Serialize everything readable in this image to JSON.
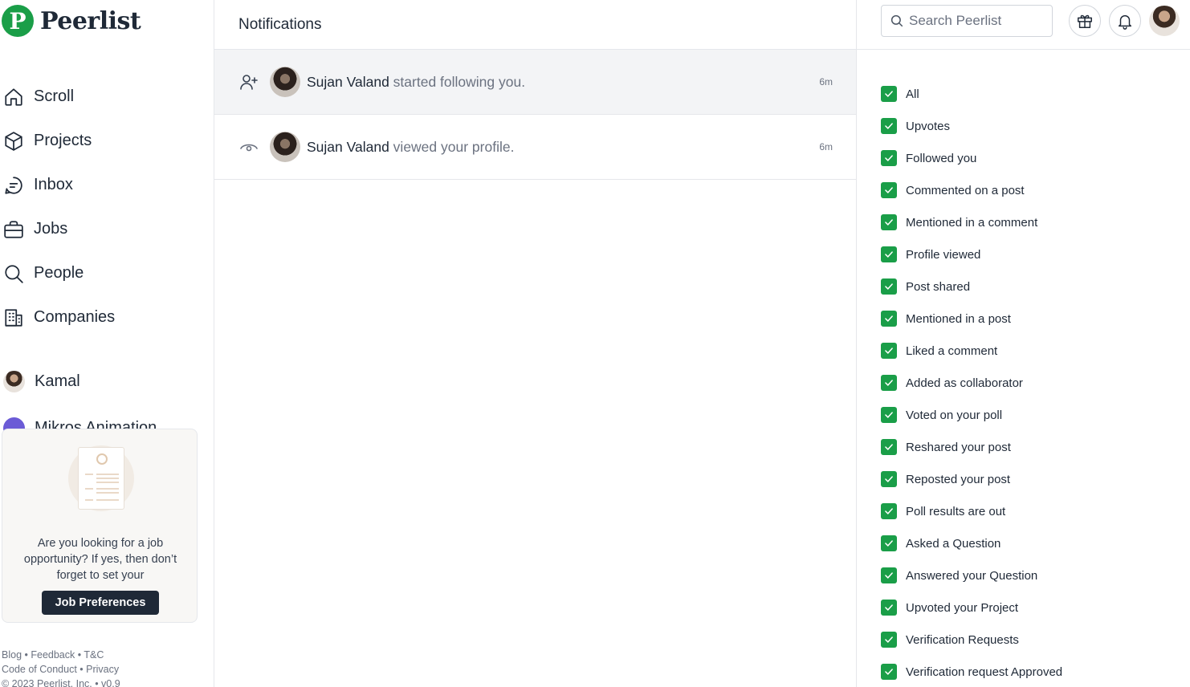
{
  "brand": {
    "name": "Peerlist",
    "badge_letter": "P",
    "color": "#1a9e48"
  },
  "nav": [
    {
      "label": "Scroll",
      "icon": "home-icon"
    },
    {
      "label": "Projects",
      "icon": "cube-icon"
    },
    {
      "label": "Inbox",
      "icon": "chat-icon"
    },
    {
      "label": "Jobs",
      "icon": "briefcase-icon"
    },
    {
      "label": "People",
      "icon": "search-icon"
    },
    {
      "label": "Companies",
      "icon": "building-icon"
    }
  ],
  "profile": {
    "name": "Kamal"
  },
  "secondary_profile": {
    "name": "Mikros Animation"
  },
  "job_card": {
    "text": "Are you looking for a job opportunity? If yes, then don’t forget to set your",
    "button": "Job Preferences"
  },
  "footer": {
    "blog": "Blog",
    "feedback": "Feedback",
    "tc": "T&C",
    "conduct": "Code of Conduct",
    "privacy": "Privacy",
    "copyright": "© 2023 Peerlist, Inc. • v0.9"
  },
  "main": {
    "title": "Notifications",
    "notifications": [
      {
        "icon": "user-plus-icon",
        "user": "Sujan Valand",
        "action": " started following you.",
        "time": "6m",
        "unread": true
      },
      {
        "icon": "eye-icon",
        "user": "Sujan Valand",
        "action": " viewed your profile.",
        "time": "6m",
        "unread": false
      }
    ]
  },
  "search": {
    "placeholder": "Search Peerlist"
  },
  "filters": [
    "All",
    "Upvotes",
    "Followed you",
    "Commented on a post",
    "Mentioned in a comment",
    "Profile viewed",
    "Post shared",
    "Mentioned in a post",
    "Liked a comment",
    "Added as collaborator",
    "Voted on your poll",
    "Reshared your post",
    "Reposted your post",
    "Poll results are out",
    "Asked a Question",
    "Answered your Question",
    "Upvoted your Project",
    "Verification Requests",
    "Verification request Approved"
  ]
}
